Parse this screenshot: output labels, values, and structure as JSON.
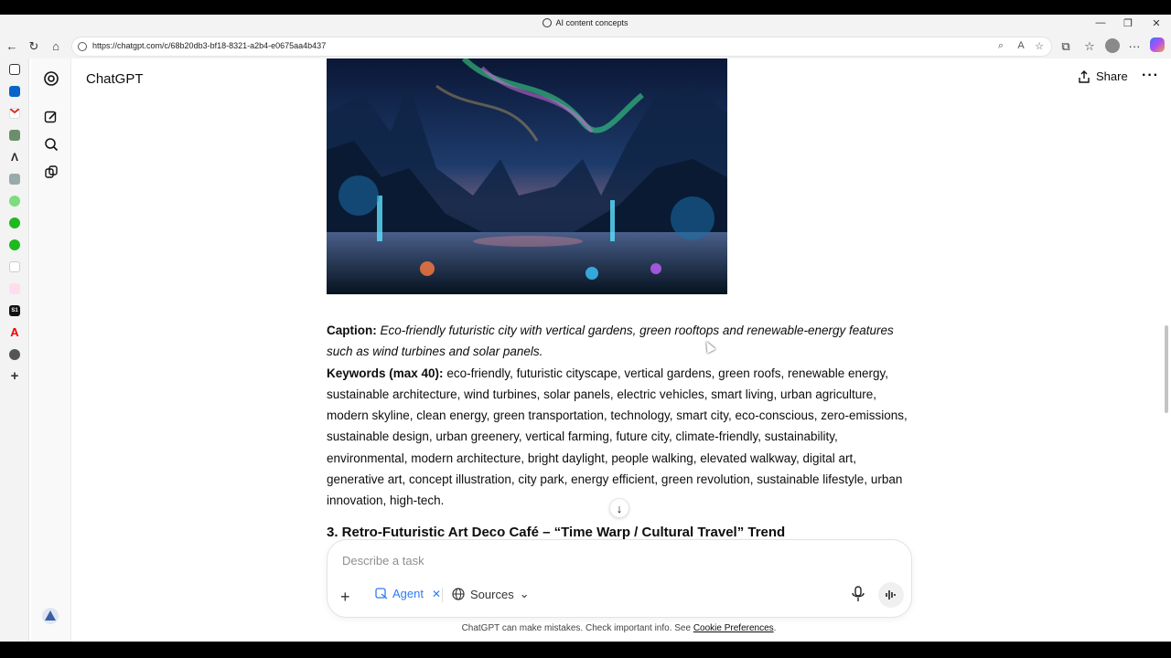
{
  "window": {
    "title": "AI content concepts",
    "controls": [
      "—",
      "❐",
      "✕"
    ]
  },
  "browser": {
    "url": "https://chatgpt.com/c/68b20db3-bf18-8321-a2b4-e0675aa4b437",
    "nav_icons": [
      "back-icon",
      "refresh-icon",
      "home-icon"
    ]
  },
  "app": {
    "name": "ChatGPT",
    "share_label": "Share",
    "more_label": "···"
  },
  "message": {
    "caption_label": "Caption:",
    "caption_text": "Eco-friendly futuristic city with vertical gardens, green rooftops and renewable-energy features such as wind turbines and solar panels.",
    "keywords_label": "Keywords (max 40):",
    "keywords_text": "eco-friendly, futuristic cityscape, vertical gardens, green roofs, renewable energy, sustainable architecture, wind turbines, solar panels, electric vehicles, smart living, urban agriculture, modern skyline, clean energy, green transportation, technology, smart city, eco-conscious, zero-emissions, sustainable design, urban greenery, vertical farming, future city, climate-friendly, sustainability, environmental, modern architecture, bright daylight, people walking, elevated walkway, digital art, generative art, concept illustration, city park, energy efficient, green revolution, sustainable lifestyle, urban innovation, high-tech.",
    "next_heading": "3. Retro-Futuristic Art Deco Café – “Time Warp / Cultural Travel” Trend"
  },
  "composer": {
    "placeholder": "Describe a task",
    "agent_label": "Agent",
    "sources_label": "Sources"
  },
  "footer": {
    "disclaimer": "ChatGPT can make mistakes. Check important info. See ",
    "link": "Cookie Preferences",
    "end": "."
  },
  "colors": {
    "accent": "#2e7bf6",
    "text": "#0d0d0d"
  }
}
